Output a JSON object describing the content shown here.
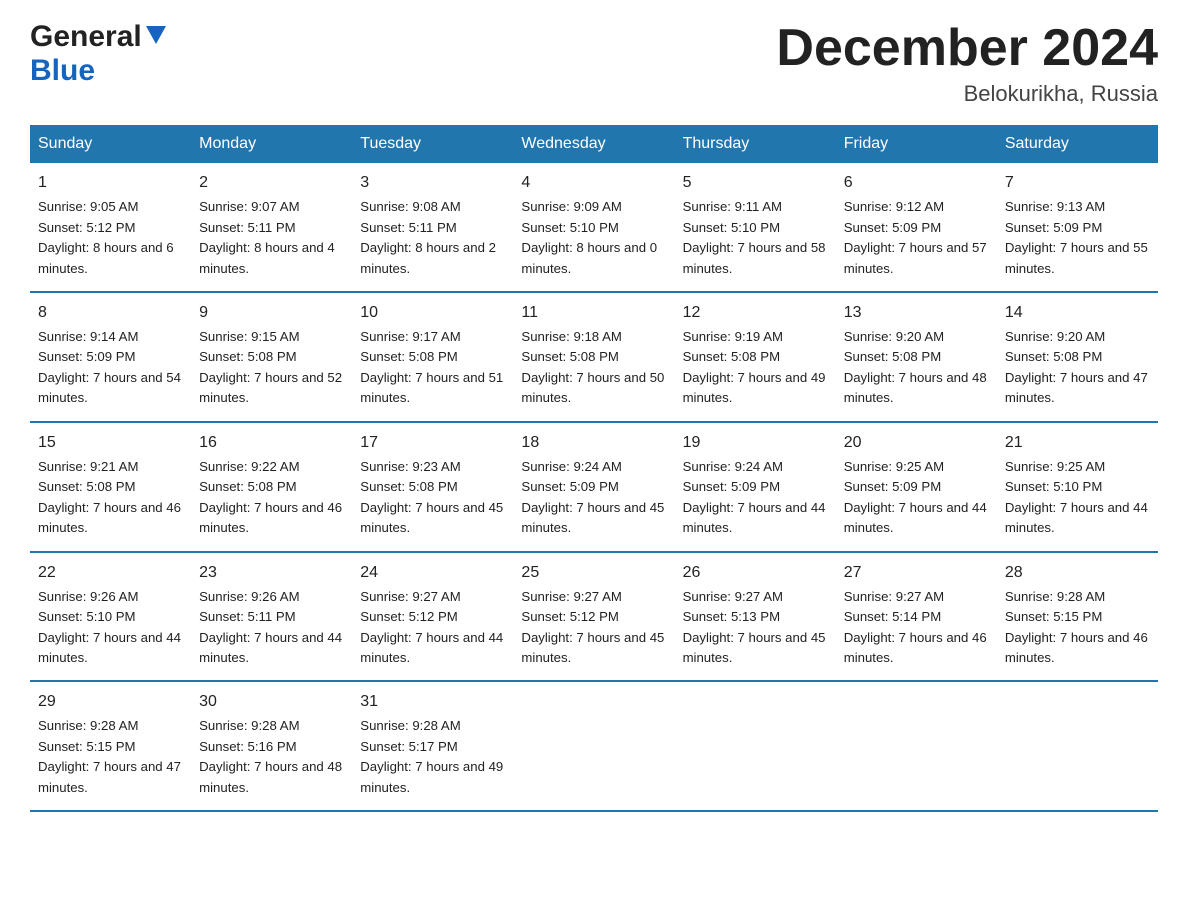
{
  "header": {
    "logo_general": "General",
    "logo_blue": "Blue",
    "month_title": "December 2024",
    "location": "Belokurikha, Russia"
  },
  "days_of_week": [
    "Sunday",
    "Monday",
    "Tuesday",
    "Wednesday",
    "Thursday",
    "Friday",
    "Saturday"
  ],
  "weeks": [
    [
      {
        "day": "1",
        "sunrise": "9:05 AM",
        "sunset": "5:12 PM",
        "daylight": "8 hours and 6 minutes."
      },
      {
        "day": "2",
        "sunrise": "9:07 AM",
        "sunset": "5:11 PM",
        "daylight": "8 hours and 4 minutes."
      },
      {
        "day": "3",
        "sunrise": "9:08 AM",
        "sunset": "5:11 PM",
        "daylight": "8 hours and 2 minutes."
      },
      {
        "day": "4",
        "sunrise": "9:09 AM",
        "sunset": "5:10 PM",
        "daylight": "8 hours and 0 minutes."
      },
      {
        "day": "5",
        "sunrise": "9:11 AM",
        "sunset": "5:10 PM",
        "daylight": "7 hours and 58 minutes."
      },
      {
        "day": "6",
        "sunrise": "9:12 AM",
        "sunset": "5:09 PM",
        "daylight": "7 hours and 57 minutes."
      },
      {
        "day": "7",
        "sunrise": "9:13 AM",
        "sunset": "5:09 PM",
        "daylight": "7 hours and 55 minutes."
      }
    ],
    [
      {
        "day": "8",
        "sunrise": "9:14 AM",
        "sunset": "5:09 PM",
        "daylight": "7 hours and 54 minutes."
      },
      {
        "day": "9",
        "sunrise": "9:15 AM",
        "sunset": "5:08 PM",
        "daylight": "7 hours and 52 minutes."
      },
      {
        "day": "10",
        "sunrise": "9:17 AM",
        "sunset": "5:08 PM",
        "daylight": "7 hours and 51 minutes."
      },
      {
        "day": "11",
        "sunrise": "9:18 AM",
        "sunset": "5:08 PM",
        "daylight": "7 hours and 50 minutes."
      },
      {
        "day": "12",
        "sunrise": "9:19 AM",
        "sunset": "5:08 PM",
        "daylight": "7 hours and 49 minutes."
      },
      {
        "day": "13",
        "sunrise": "9:20 AM",
        "sunset": "5:08 PM",
        "daylight": "7 hours and 48 minutes."
      },
      {
        "day": "14",
        "sunrise": "9:20 AM",
        "sunset": "5:08 PM",
        "daylight": "7 hours and 47 minutes."
      }
    ],
    [
      {
        "day": "15",
        "sunrise": "9:21 AM",
        "sunset": "5:08 PM",
        "daylight": "7 hours and 46 minutes."
      },
      {
        "day": "16",
        "sunrise": "9:22 AM",
        "sunset": "5:08 PM",
        "daylight": "7 hours and 46 minutes."
      },
      {
        "day": "17",
        "sunrise": "9:23 AM",
        "sunset": "5:08 PM",
        "daylight": "7 hours and 45 minutes."
      },
      {
        "day": "18",
        "sunrise": "9:24 AM",
        "sunset": "5:09 PM",
        "daylight": "7 hours and 45 minutes."
      },
      {
        "day": "19",
        "sunrise": "9:24 AM",
        "sunset": "5:09 PM",
        "daylight": "7 hours and 44 minutes."
      },
      {
        "day": "20",
        "sunrise": "9:25 AM",
        "sunset": "5:09 PM",
        "daylight": "7 hours and 44 minutes."
      },
      {
        "day": "21",
        "sunrise": "9:25 AM",
        "sunset": "5:10 PM",
        "daylight": "7 hours and 44 minutes."
      }
    ],
    [
      {
        "day": "22",
        "sunrise": "9:26 AM",
        "sunset": "5:10 PM",
        "daylight": "7 hours and 44 minutes."
      },
      {
        "day": "23",
        "sunrise": "9:26 AM",
        "sunset": "5:11 PM",
        "daylight": "7 hours and 44 minutes."
      },
      {
        "day": "24",
        "sunrise": "9:27 AM",
        "sunset": "5:12 PM",
        "daylight": "7 hours and 44 minutes."
      },
      {
        "day": "25",
        "sunrise": "9:27 AM",
        "sunset": "5:12 PM",
        "daylight": "7 hours and 45 minutes."
      },
      {
        "day": "26",
        "sunrise": "9:27 AM",
        "sunset": "5:13 PM",
        "daylight": "7 hours and 45 minutes."
      },
      {
        "day": "27",
        "sunrise": "9:27 AM",
        "sunset": "5:14 PM",
        "daylight": "7 hours and 46 minutes."
      },
      {
        "day": "28",
        "sunrise": "9:28 AM",
        "sunset": "5:15 PM",
        "daylight": "7 hours and 46 minutes."
      }
    ],
    [
      {
        "day": "29",
        "sunrise": "9:28 AM",
        "sunset": "5:15 PM",
        "daylight": "7 hours and 47 minutes."
      },
      {
        "day": "30",
        "sunrise": "9:28 AM",
        "sunset": "5:16 PM",
        "daylight": "7 hours and 48 minutes."
      },
      {
        "day": "31",
        "sunrise": "9:28 AM",
        "sunset": "5:17 PM",
        "daylight": "7 hours and 49 minutes."
      },
      null,
      null,
      null,
      null
    ]
  ]
}
